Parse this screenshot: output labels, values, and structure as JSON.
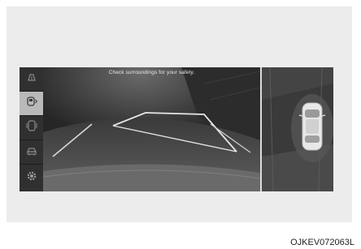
{
  "screen": {
    "warning_text": "Check surroundings for your safety."
  },
  "sidebar": {
    "items": [
      {
        "icon": "parking-guidance-icon",
        "active": false
      },
      {
        "icon": "rear-camera-view-icon",
        "active": true
      },
      {
        "icon": "side-view-icon",
        "active": false
      },
      {
        "icon": "surround-view-icon",
        "active": false
      },
      {
        "icon": "settings-gear-icon",
        "active": false
      }
    ]
  },
  "figure": {
    "code": "OJKEV072063L"
  },
  "colors": {
    "screen_bg": "#2a2a2a",
    "active_button": "#b9b9b9",
    "guide_lines": "#e6e6e6"
  }
}
